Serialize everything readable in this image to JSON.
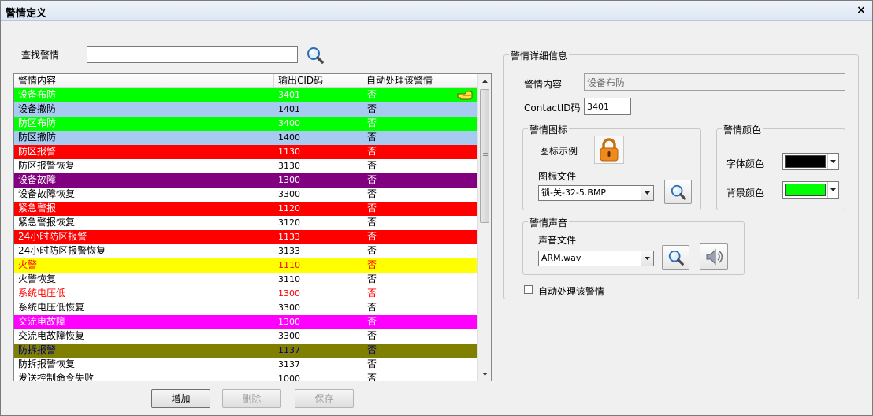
{
  "window": {
    "title": "警情定义",
    "close_glyph": "×"
  },
  "search": {
    "label": "查找警情",
    "value": "",
    "button_icon": "magnifier-icon"
  },
  "list": {
    "columns": [
      "警情内容",
      "输出CID码",
      "自动处理该警情"
    ],
    "rows": [
      {
        "name": "设备布防",
        "cid": "3401",
        "auto": "否",
        "bg": "#00ff00",
        "fg": "#ffffff",
        "selected": true
      },
      {
        "name": "设备撤防",
        "cid": "1401",
        "auto": "否",
        "bg": "#a6caf0",
        "fg": "#000000"
      },
      {
        "name": "防区布防",
        "cid": "3400",
        "auto": "否",
        "bg": "#00ff00",
        "fg": "#ffffff"
      },
      {
        "name": "防区撤防",
        "cid": "1400",
        "auto": "否",
        "bg": "#a6caf0",
        "fg": "#000000"
      },
      {
        "name": "防区报警",
        "cid": "1130",
        "auto": "否",
        "bg": "#ff0000",
        "fg": "#ffffff"
      },
      {
        "name": "防区报警恢复",
        "cid": "3130",
        "auto": "否",
        "bg": "#ffffff",
        "fg": "#000000"
      },
      {
        "name": "设备故障",
        "cid": "1300",
        "auto": "否",
        "bg": "#800080",
        "fg": "#ffffff"
      },
      {
        "name": "设备故障恢复",
        "cid": "3300",
        "auto": "否",
        "bg": "#ffffff",
        "fg": "#000000"
      },
      {
        "name": "紧急警报",
        "cid": "1120",
        "auto": "否",
        "bg": "#ff0000",
        "fg": "#ffffff"
      },
      {
        "name": "紧急警报恢复",
        "cid": "3120",
        "auto": "否",
        "bg": "#ffffff",
        "fg": "#000000"
      },
      {
        "name": "24小时防区报警",
        "cid": "1133",
        "auto": "否",
        "bg": "#ff0000",
        "fg": "#ffffff"
      },
      {
        "name": "24小时防区报警恢复",
        "cid": "3133",
        "auto": "否",
        "bg": "#ffffff",
        "fg": "#000000"
      },
      {
        "name": "火警",
        "cid": "1110",
        "auto": "否",
        "bg": "#ffff00",
        "fg": "#ff0000"
      },
      {
        "name": "火警恢复",
        "cid": "3110",
        "auto": "否",
        "bg": "#ffffff",
        "fg": "#000000"
      },
      {
        "name": "系统电压低",
        "cid": "1300",
        "auto": "否",
        "bg": "#ffffff",
        "fg": "#ff0000"
      },
      {
        "name": "系统电压低恢复",
        "cid": "3300",
        "auto": "否",
        "bg": "#ffffff",
        "fg": "#000000"
      },
      {
        "name": "交流电故障",
        "cid": "1300",
        "auto": "否",
        "bg": "#ff00ff",
        "fg": "#ffffff"
      },
      {
        "name": "交流电故障恢复",
        "cid": "3300",
        "auto": "否",
        "bg": "#ffffff",
        "fg": "#000000"
      },
      {
        "name": "防拆报警",
        "cid": "1137",
        "auto": "否",
        "bg": "#808000",
        "fg": "#000080"
      },
      {
        "name": "防拆报警恢复",
        "cid": "3137",
        "auto": "否",
        "bg": "#ffffff",
        "fg": "#000000"
      },
      {
        "name": "发送控制命令失败",
        "cid": "1000",
        "auto": "否",
        "bg": "#ffffff",
        "fg": "#000000"
      }
    ]
  },
  "buttons": {
    "add": "增加",
    "delete": "删除",
    "save": "保存"
  },
  "details": {
    "group_title": "警情详细信息",
    "content_label": "警情内容",
    "content_value": "设备布防",
    "cid_label": "ContactID码",
    "cid_value": "3401",
    "icon_group": {
      "title": "警情图标",
      "example_label": "图标示例",
      "example_icon": "padlock-icon",
      "file_label": "图标文件",
      "file_value": "锁-关-32-5.BMP"
    },
    "color_group": {
      "title": "警情颜色",
      "font_label": "字体颜色",
      "font_color": "#000000",
      "bg_label": "背景颜色",
      "bg_color": "#00ff00"
    },
    "sound_group": {
      "title": "警情声音",
      "file_label": "声音文件",
      "file_value": "ARM.wav",
      "play_icon": "speaker-icon"
    },
    "auto_label": "自动处理该警情",
    "auto_checked": false
  }
}
